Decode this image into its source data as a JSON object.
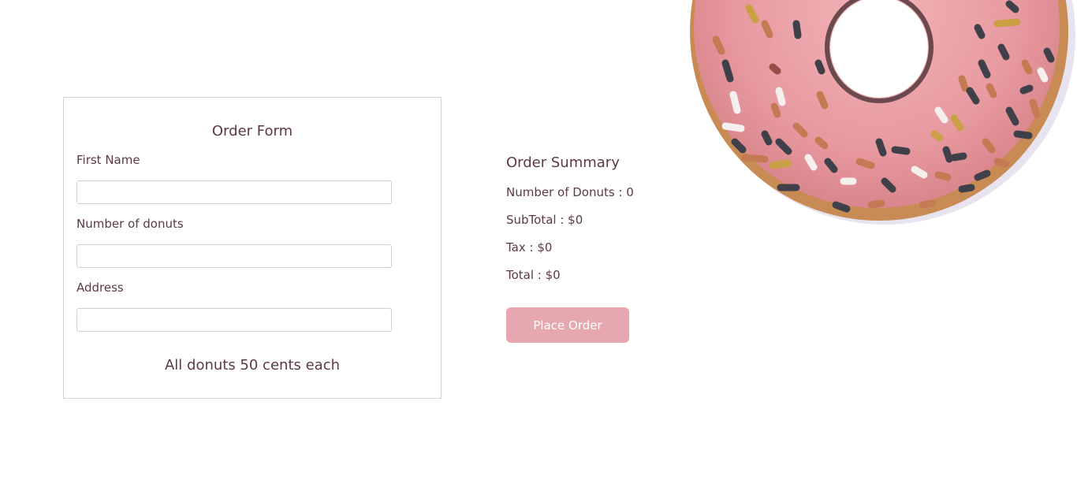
{
  "order_form": {
    "title": "Order Form",
    "fields": [
      {
        "label": "First Name",
        "value": "",
        "placeholder": ""
      },
      {
        "label": "Number of donuts",
        "value": "",
        "placeholder": ""
      },
      {
        "label": "Address",
        "value": "",
        "placeholder": ""
      }
    ],
    "price_note": "All donuts 50 cents each"
  },
  "summary": {
    "title": "Order Summary",
    "rows": [
      "Number of Donuts : 0",
      "SubTotal : $0",
      "Tax : $0",
      "Total : $0"
    ],
    "button_label": "Place Order"
  },
  "colors": {
    "text": "#5b3b40",
    "button": "#e6a8ae",
    "donut_frosting": "#e89aa0",
    "donut_dough": "#c98b54"
  },
  "decoration": {
    "image": "donut-image"
  }
}
